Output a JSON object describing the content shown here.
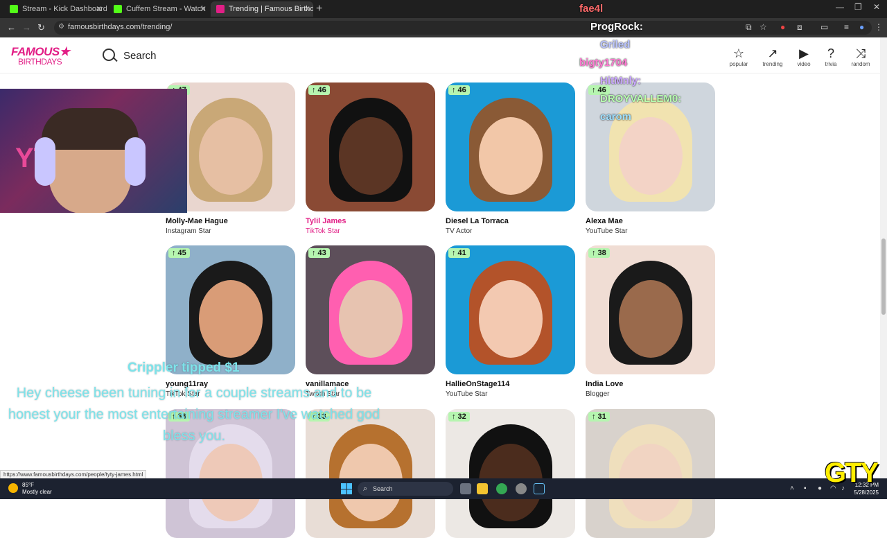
{
  "tabs": [
    {
      "title": "Stream - Kick Dashboard",
      "favicon_color": "#53fc18"
    },
    {
      "title": "Cuffem Stream - Watch Live on",
      "favicon_color": "#53fc18"
    },
    {
      "title": "Trending | Famous Birthdays",
      "favicon_color": "#e21f86"
    }
  ],
  "url": "famousbirthdays.com/trending/",
  "site": {
    "logo_top": "FAMOUS★",
    "logo_bottom": "BIRTHDAYS",
    "search_label": "Search",
    "nav": [
      {
        "label": "popular",
        "icon": "star-icon"
      },
      {
        "label": "trending",
        "icon": "trending-icon"
      },
      {
        "label": "video",
        "icon": "video-icon"
      },
      {
        "label": "trivia",
        "icon": "question-icon"
      },
      {
        "label": "random",
        "icon": "shuffle-icon"
      }
    ]
  },
  "cards": [
    {
      "rank": "↑ 47",
      "name": "Molly-Mae Hague",
      "role": "Instagram Star",
      "bg": "#e9d6cf",
      "skin": "#e6bfa3",
      "hair": "#c9a877"
    },
    {
      "rank": "↑ 46",
      "name": "Tylil James",
      "role": "TikTok Star",
      "bg": "#8a4a34",
      "skin": "#5b3524",
      "hair": "#111111",
      "hover": true
    },
    {
      "rank": "↑ 46",
      "name": "Diesel La Torraca",
      "role": "TV Actor",
      "bg": "#1b9ad6",
      "skin": "#f2c7a8",
      "hair": "#8a5a36"
    },
    {
      "rank": "↑ 46",
      "name": "Alexa Mae",
      "role": "YouTube Star",
      "bg": "#cfd6dd",
      "skin": "#f3d3c6",
      "hair": "#f1e3b0"
    },
    {
      "rank": "↑ 45",
      "name": "young11ray",
      "role": "TikTok Star",
      "bg": "#8fb0c9",
      "skin": "#d99c77",
      "hair": "#1a1a1a"
    },
    {
      "rank": "↑ 43",
      "name": "vanillamace",
      "role": "Twitch Star",
      "bg": "#5d4f5a",
      "skin": "#e7c3b0",
      "hair": "#ff5fb0"
    },
    {
      "rank": "↑ 41",
      "name": "HallieOnStage114",
      "role": "YouTube Star",
      "bg": "#1b9ad6",
      "skin": "#f3c9b1",
      "hair": "#b3532a"
    },
    {
      "rank": "↑ 38",
      "name": "India Love",
      "role": "Blogger",
      "bg": "#f0ddd4",
      "skin": "#9a6a4c",
      "hair": "#1a1a1a"
    },
    {
      "rank": "↑ 36",
      "name": "",
      "role": "",
      "bg": "#cfc4d6",
      "skin": "#eec9b8",
      "hair": "#e4dcec"
    },
    {
      "rank": "↑ 33",
      "name": "",
      "role": "",
      "bg": "#e8ddd6",
      "skin": "#efc8ad",
      "hair": "#b6712f"
    },
    {
      "rank": "↑ 32",
      "name": "",
      "role": "",
      "bg": "#ece8e4",
      "skin": "#4b2c1d",
      "hair": "#111111"
    },
    {
      "rank": "↑ 31",
      "name": "",
      "role": "",
      "bg": "#d8d2cc",
      "skin": "#f1d4c2",
      "hair": "#efdfbd"
    }
  ],
  "chat": [
    {
      "user": "fae4l",
      "color": "#ff6a6a"
    },
    {
      "user": "ProgRock:",
      "color": "#ffffff"
    },
    {
      "user": "Griled",
      "color": "#b9c4ff"
    },
    {
      "user": "bigty1704",
      "color": "#ff7ad2"
    },
    {
      "user": "HitMnly:",
      "color": "#c9a6ff"
    },
    {
      "user": "DROYVALLEM0:",
      "color": "#b8ffb0"
    },
    {
      "user": "carom",
      "color": "#9ee0ff"
    }
  ],
  "tip": {
    "title": "Crippler tipped $1",
    "message": "Hey cheese been tuning in for a couple streams and to be honest your the most entertaining streamer I've watched god bless you."
  },
  "webcam_sign": "YTG",
  "status_url": "https://www.famousbirthdays.com/people/tyty-james.html",
  "taskbar": {
    "temp": "85°F",
    "weather": "Mostly clear",
    "search": "Search",
    "time": "12:32 PM",
    "date": "5/28/2025"
  },
  "watermark": "GTY"
}
